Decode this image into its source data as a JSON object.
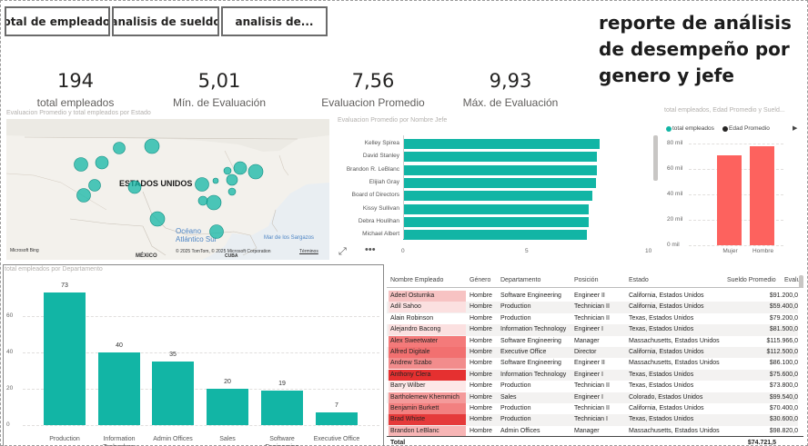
{
  "tabs": [
    "total de empleados",
    "analisis de sueldo",
    "analisis de..."
  ],
  "report_title": "reporte de análisis de desempeño por genero y jefe",
  "kpis": [
    {
      "value": "194",
      "label": "total empleados"
    },
    {
      "value": "5,01",
      "label": "Mín. de Evaluación"
    },
    {
      "value": "7,56",
      "label": "Evaluacion Promedio"
    },
    {
      "value": "9,93",
      "label": "Máx. de Evaluación"
    }
  ],
  "map": {
    "title": "Evaluacion Promedio y total empleados por Estado",
    "country": "ESTADOS UNIDOS",
    "ocean": "Océano\nAtlántico Sur",
    "sargazo": "Mar de los Sargazos",
    "mexico": "MÉXICO",
    "cuba": "CUBA",
    "bing": "Microsoft Bing",
    "copyright": "© 2025 TomTom, © 2025 Microsoft Corporation",
    "terms": "Términos"
  },
  "manager_chart": {
    "title": "Evaluacion Promedio por Nombre Jefe",
    "ticks": [
      "0",
      "5",
      "10"
    ],
    "chart_data": {
      "type": "bar",
      "orientation": "horizontal",
      "categories": [
        "Kelley Spirea",
        "David Stanley",
        "Brandon R. LeBlanc",
        "Elijiah Gray",
        "Board of Directors",
        "Kissy Sullivan",
        "Debra Houlihan",
        "Michael Albert"
      ],
      "values": [
        8.05,
        7.95,
        7.95,
        7.9,
        7.75,
        7.6,
        7.6,
        7.55
      ],
      "xlim": [
        0,
        10
      ]
    }
  },
  "gender_chart": {
    "title": "total empleados, Edad Promedio y Sueld...",
    "legend": [
      "total empleados",
      "Edad Promedio"
    ],
    "legend_colors": [
      "#12b5a5",
      "#252423"
    ],
    "yticks": [
      "80 mil",
      "60 mil",
      "40 mil",
      "20 mil",
      "0 mil"
    ],
    "chart_data": {
      "type": "bar",
      "categories": [
        "Mujer",
        "Hombre"
      ],
      "values": [
        71000,
        78000
      ],
      "ylim": [
        0,
        80000
      ]
    },
    "bar_color": "#fd625e"
  },
  "dept_chart": {
    "title": "total empleados por Departamento",
    "yticks": [
      "60",
      "40",
      "20",
      "0"
    ],
    "chart_data": {
      "type": "bar",
      "categories": [
        "Production",
        "Information Technology",
        "Admin Offices",
        "Sales",
        "Software Engineering",
        "Executive Office"
      ],
      "values": [
        73,
        40,
        35,
        20,
        19,
        7
      ],
      "ylim": [
        0,
        80
      ]
    },
    "bar_color": "#12b5a5"
  },
  "table": {
    "headers": [
      "Nombre Empleado",
      "Género",
      "Departamento",
      "Posición",
      "Estado",
      "Sueldo Promedio",
      "Evalu"
    ],
    "rows": [
      {
        "name": "Adeel Osturnka",
        "gender": "Hombre",
        "dept": "Software Engineering",
        "position": "Engineer II",
        "state": "California, Estados Unidos",
        "salary": "$91.200,0",
        "heat": "#f7c3c3"
      },
      {
        "name": "Adil Sahoo",
        "gender": "Hombre",
        "dept": "Production",
        "position": "Technician II",
        "state": "California, Estados Unidos",
        "salary": "$59.400,0",
        "heat": "#fbe0e0"
      },
      {
        "name": "Alain Robinson",
        "gender": "Hombre",
        "dept": "Production",
        "position": "Technician II",
        "state": "Texas, Estados Unidos",
        "salary": "$79.200,0",
        "heat": "#ffffff"
      },
      {
        "name": "Alejandro Bacong",
        "gender": "Hombre",
        "dept": "Information Technology",
        "position": "Engineer I",
        "state": "Texas, Estados Unidos",
        "salary": "$81.500,0",
        "heat": "#fbe0e0"
      },
      {
        "name": "Alex Sweetwater",
        "gender": "Hombre",
        "dept": "Software Engineering",
        "position": "Manager",
        "state": "Massachusetts, Estados Unidos",
        "salary": "$115.966,0",
        "heat": "#f47a7a"
      },
      {
        "name": "Alfred Digitale",
        "gender": "Hombre",
        "dept": "Executive Office",
        "position": "Director",
        "state": "California, Estados Unidos",
        "salary": "$112.500,0",
        "heat": "#f27070"
      },
      {
        "name": "Andrew Szabo",
        "gender": "Hombre",
        "dept": "Software Engineering",
        "position": "Engineer II",
        "state": "Massachusetts, Estados Unidos",
        "salary": "$86.100,0",
        "heat": "#f28c8c"
      },
      {
        "name": "Anthony Clera",
        "gender": "Hombre",
        "dept": "Information Technology",
        "position": "Engineer I",
        "state": "Texas, Estados Unidos",
        "salary": "$75.600,0",
        "heat": "#e53030"
      },
      {
        "name": "Barry Wilber",
        "gender": "Hombre",
        "dept": "Production",
        "position": "Technician II",
        "state": "Texas, Estados Unidos",
        "salary": "$73.800,0",
        "heat": "#fde8e8"
      },
      {
        "name": "Bartholemew Khemmich",
        "gender": "Hombre",
        "dept": "Sales",
        "position": "Engineer I",
        "state": "Colorado, Estados Unidos",
        "salary": "$99.540,0",
        "heat": "#f49a9a"
      },
      {
        "name": "Benjamin Burkett",
        "gender": "Hombre",
        "dept": "Production",
        "position": "Technician II",
        "state": "California, Estados Unidos",
        "salary": "$70.400,0",
        "heat": "#f28080"
      },
      {
        "name": "Brad Whiste",
        "gender": "Hombre",
        "dept": "Production",
        "position": "Technician I",
        "state": "Texas, Estados Unidos",
        "salary": "$30.600,0",
        "heat": "#e53a3a"
      },
      {
        "name": "Brandon LeBlanc",
        "gender": "Hombre",
        "dept": "Admin Offices",
        "position": "Manager",
        "state": "Massachusetts, Estados Unidos",
        "salary": "$98.820,0",
        "heat": "#f7b5b5"
      }
    ],
    "total_label": "Total",
    "total_value": "$74.721,5"
  }
}
